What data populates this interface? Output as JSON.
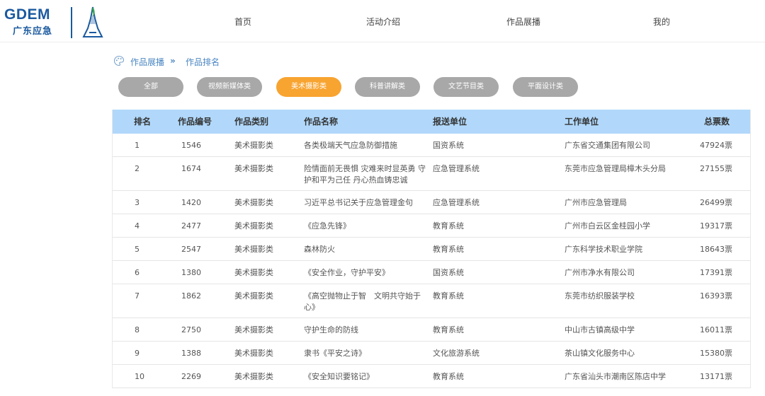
{
  "brand": {
    "name": "GDEM",
    "subtitle": "广东应急"
  },
  "nav": [
    {
      "label": "首页"
    },
    {
      "label": "活动介绍"
    },
    {
      "label": "作品展播"
    },
    {
      "label": "我的"
    }
  ],
  "breadcrumb": {
    "parent": "作品展播",
    "separator": "»",
    "current": "作品排名",
    "icon": "palette-icon"
  },
  "categories": [
    {
      "label": "全部",
      "active": false
    },
    {
      "label": "视频新媒体类",
      "active": false
    },
    {
      "label": "美术摄影类",
      "active": true
    },
    {
      "label": "科普讲解类",
      "active": false
    },
    {
      "label": "文艺节目类",
      "active": false
    },
    {
      "label": "平面设计类",
      "active": false
    }
  ],
  "colors": {
    "active_pill": "#f8a431",
    "inactive_pill": "#a8a8a8",
    "table_header": "#b1d8fb",
    "link": "#4a86c2",
    "brand": "#1b5a9f"
  },
  "table": {
    "headers": [
      "排名",
      "作品编号",
      "作品类别",
      "作品名称",
      "报送单位",
      "工作单位",
      "总票数"
    ],
    "rows": [
      [
        "1",
        "1546",
        "美术摄影类",
        "各类极端天气应急防御措施",
        "国资系统",
        "广东省交通集团有限公司",
        "47924票"
      ],
      [
        "2",
        "1674",
        "美术摄影类",
        "险情面前无畏惧 灾难来时显英勇 守护和平为己任 丹心热血铸忠诚",
        "应急管理系统",
        "东莞市应急管理局樟木头分局",
        "27155票"
      ],
      [
        "3",
        "1420",
        "美术摄影类",
        "习近平总书记关于应急管理金句",
        "应急管理系统",
        "广州市应急管理局",
        "26499票"
      ],
      [
        "4",
        "2477",
        "美术摄影类",
        "《应急先锋》",
        "教育系统",
        "广州市白云区金桂园小学",
        "19317票"
      ],
      [
        "5",
        "2547",
        "美术摄影类",
        "森林防火",
        "教育系统",
        "广东科学技术职业学院",
        "18643票"
      ],
      [
        "6",
        "1380",
        "美术摄影类",
        "《安全作业，守护平安》",
        "国资系统",
        "广州市净水有限公司",
        "17391票"
      ],
      [
        "7",
        "1862",
        "美术摄影类",
        "《高空抛物止于智　文明共守始于心》",
        "教育系统",
        "东莞市纺织服装学校",
        "16393票"
      ],
      [
        "8",
        "2750",
        "美术摄影类",
        "守护生命的防线",
        "教育系统",
        "中山市古镇高级中学",
        "16011票"
      ],
      [
        "9",
        "1388",
        "美术摄影类",
        "隶书《平安之诗》",
        "文化旅游系统",
        "茶山镇文化服务中心",
        "15380票"
      ],
      [
        "10",
        "2269",
        "美术摄影类",
        "《安全知识要铭记》",
        "教育系统",
        "广东省汕头市潮南区陈店中学",
        "13171票"
      ]
    ]
  }
}
